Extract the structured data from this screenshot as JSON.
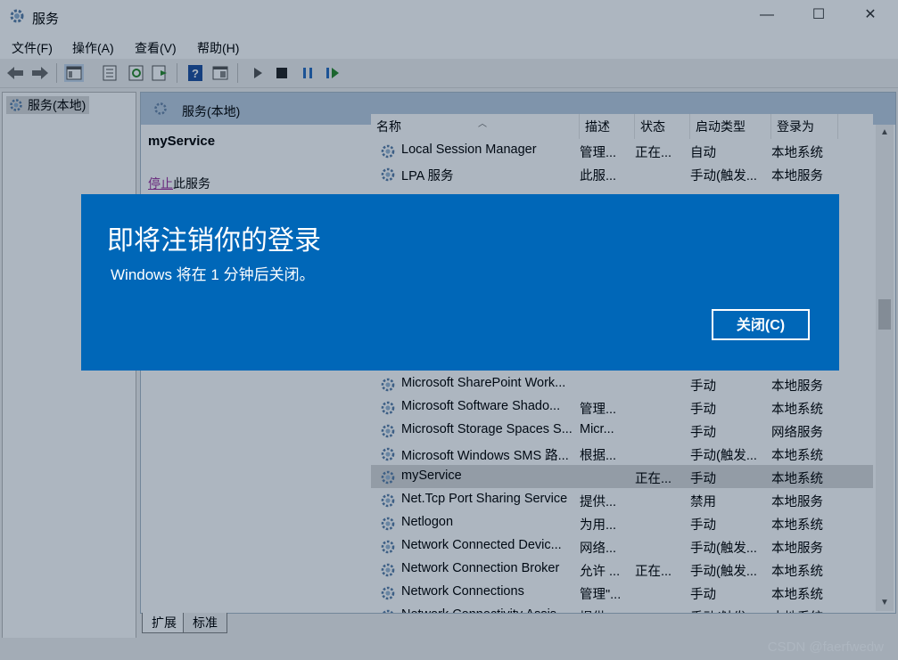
{
  "window": {
    "title": "服务",
    "minimize_glyph": "—",
    "maximize_glyph": "☐",
    "close_glyph": "✕"
  },
  "menu": [
    "文件(F)",
    "操作(A)",
    "查看(V)",
    "帮助(H)"
  ],
  "toolbar_icons": [
    "back-arrow-icon",
    "forward-arrow-icon",
    "show-hide-tree-icon",
    "properties-icon",
    "refresh-icon",
    "export-list-icon",
    "help-icon",
    "console-view-icon",
    "start-service-icon",
    "stop-service-icon",
    "pause-service-icon",
    "resume-service-icon"
  ],
  "tree": {
    "root_label": "服务(本地)"
  },
  "pane": {
    "header_label": "服务(本地)",
    "selected_service": "myService",
    "stop_link": "停止",
    "stop_suffix": "此服务"
  },
  "columns": [
    "名称",
    "描述",
    "状态",
    "启动类型",
    "登录为"
  ],
  "services": [
    {
      "name": "Local Session Manager",
      "desc": "管理...",
      "status": "正在...",
      "startup": "自动",
      "logon": "本地系统"
    },
    {
      "name": "LPA 服务",
      "desc": "此服...",
      "status": "",
      "startup": "手动(触发...",
      "logon": "本地服务"
    },
    {
      "name": "Microsoft SharePoint Work...",
      "desc": "",
      "status": "",
      "startup": "手动",
      "logon": "本地服务"
    },
    {
      "name": "Microsoft Software Shado...",
      "desc": "管理...",
      "status": "",
      "startup": "手动",
      "logon": "本地系统"
    },
    {
      "name": "Microsoft Storage Spaces S...",
      "desc": "Micr...",
      "status": "",
      "startup": "手动",
      "logon": "网络服务"
    },
    {
      "name": "Microsoft Windows SMS 路...",
      "desc": "根据...",
      "status": "",
      "startup": "手动(触发...",
      "logon": "本地系统"
    },
    {
      "name": "myService",
      "desc": "",
      "status": "正在...",
      "startup": "手动",
      "logon": "本地系统",
      "selected": true
    },
    {
      "name": "Net.Tcp Port Sharing Service",
      "desc": "提供...",
      "status": "",
      "startup": "禁用",
      "logon": "本地服务"
    },
    {
      "name": "Netlogon",
      "desc": "为用...",
      "status": "",
      "startup": "手动",
      "logon": "本地系统"
    },
    {
      "name": "Network Connected Devic...",
      "desc": "网络...",
      "status": "",
      "startup": "手动(触发...",
      "logon": "本地服务"
    },
    {
      "name": "Network Connection Broker",
      "desc": "允许 ...",
      "status": "正在...",
      "startup": "手动(触发...",
      "logon": "本地系统"
    },
    {
      "name": "Network Connections",
      "desc": "管理\"...",
      "status": "",
      "startup": "手动",
      "logon": "本地系统"
    },
    {
      "name": "Network Connectivity Assis...",
      "desc": "提供...",
      "status": "",
      "startup": "手动(触发...",
      "logon": "本地系统"
    }
  ],
  "tabs": [
    "扩展",
    "标准"
  ],
  "watermark": "CSDN @faerfwedw",
  "dialog": {
    "title": "即将注销你的登录",
    "message": "Windows 将在 1 分钟后关闭。",
    "close_button": "关闭(C)",
    "color": "#0067b8"
  }
}
